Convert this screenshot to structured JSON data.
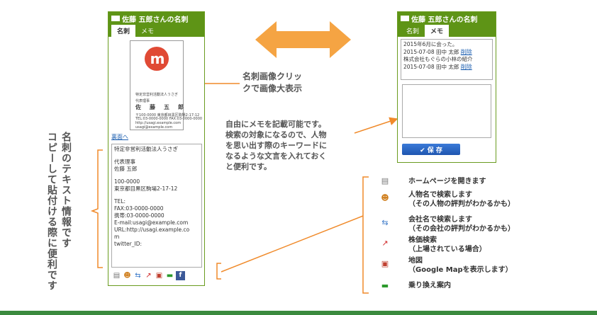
{
  "left_panel": {
    "title": "佐藤 五郎さんの名刺",
    "tabs": [
      "名刺",
      "メモ"
    ],
    "card": {
      "logo_text": "m",
      "org": "特定非営利活動法人うさぎ",
      "role": "代表理事",
      "name": "佐　藤　五　郎",
      "addr1": "〒100-0000 東京都目黒区駒場2-17-12",
      "addr2": "TEL:03-0000-0000  FAX:03-0000-0000",
      "url": "http://usagi.example.com",
      "email": "usagi@example.com"
    },
    "back_link": "裏面へ",
    "text_lines": [
      "特定非営利活動法人うさぎ",
      "",
      "代表理事",
      "佐藤 五郎",
      "",
      "100-0000",
      "東京都目黒区駒場2-17-12",
      "",
      "TEL:",
      "FAX:03-0000-0000",
      "携帯:03-0000-0000",
      "E-mail:usagi@example.com",
      "URL:http://usagi.example.co",
      "m",
      "twitter_ID:"
    ]
  },
  "right_panel": {
    "title": "佐藤 五郎さんの名刺",
    "tabs": [
      "名刺",
      "メモ"
    ],
    "memos": [
      {
        "text": "2015年6月に会った。"
      },
      {
        "text": "2015-07-08 田中 太郎",
        "delete": "削除"
      },
      {
        "text": "株式会社もぐらの小林の紹介"
      },
      {
        "text": "2015-07-08 田中 太郎",
        "delete": "削除"
      }
    ],
    "save_label": "✔ 保 存"
  },
  "annotations": {
    "card_click": [
      "名刺画像クリッ",
      "クで画像大表示"
    ],
    "memo_desc": [
      "自由にメモを記載可能です。",
      "検索の対象になるので、人物",
      "を思い出す際のキーワードに",
      "なるような文言を入れておく",
      "と便利です。"
    ],
    "vertical_a": "名刺のテキスト情報です",
    "vertical_b": "コピーして貼付ける際に便利です"
  },
  "features": [
    {
      "icon": "homepage-icon",
      "glyph": "▤",
      "color": "#777777",
      "lines": [
        "ホームページを開きます"
      ]
    },
    {
      "icon": "person-search-icon",
      "glyph": "☻",
      "color": "#d08020",
      "lines": [
        "人物名で検索します",
        "（その人物の評判がわかるかも）"
      ]
    },
    {
      "icon": "company-search-icon",
      "glyph": "⇆",
      "color": "#3a78c8",
      "lines": [
        "会社名で検索します",
        "（その会社の評判がわかるかも）"
      ]
    },
    {
      "icon": "stock-chart-icon",
      "glyph": "↗",
      "color": "#d02a2a",
      "lines": [
        "株価検索",
        "（上場されている場合）"
      ]
    },
    {
      "icon": "map-icon",
      "glyph": "▣",
      "color": "#c04030",
      "lines": [
        "地図",
        "（Google Mapを表示します）"
      ]
    },
    {
      "icon": "train-icon",
      "glyph": "▬",
      "color": "#2c9a2c",
      "lines": [
        "乗り換え案内"
      ]
    }
  ],
  "colors": {
    "accent": "#5e9416",
    "arrow": "#f39c3a",
    "button": "#1f56b0"
  }
}
